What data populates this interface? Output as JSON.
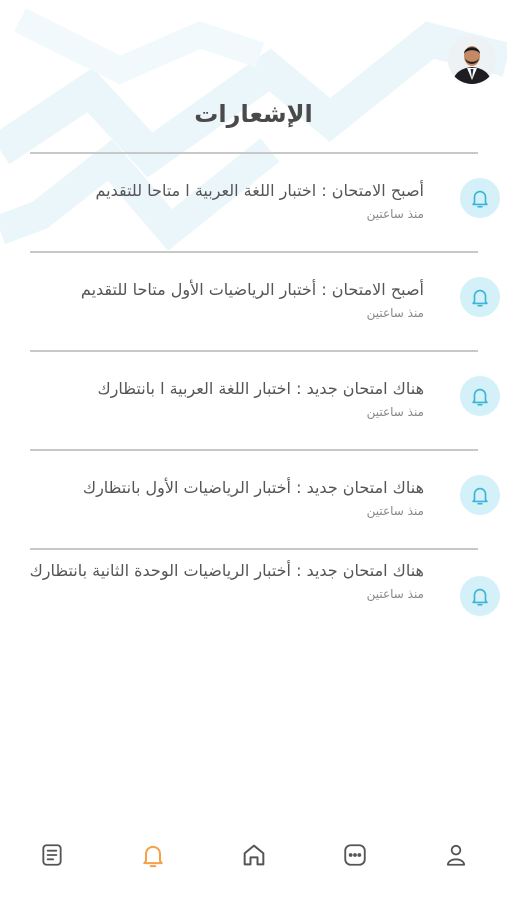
{
  "header": {
    "title": "الإشعارات"
  },
  "notifications": [
    {
      "message": "أصبح  الامتحان : اختبار اللغة العربية ا متاحا للتقديم",
      "time": "منذ ساعتين",
      "icon": "bell-icon"
    },
    {
      "message": "أصبح  الامتحان : أختبار الرياضيات الأول متاحا للتقديم",
      "time": "منذ ساعتين",
      "icon": "bell-icon"
    },
    {
      "message": "هناك  امتحان جديد : اختبار اللغة العربية ا بانتظارك",
      "time": "منذ ساعتين",
      "icon": "bell-icon"
    },
    {
      "message": "هناك  امتحان جديد : أختبار الرياضيات الأول بانتظارك",
      "time": "منذ ساعتين",
      "icon": "bell-icon"
    },
    {
      "message": "هناك  امتحان جديد : أختبار الرياضيات الوحدة الثانية بانتظارك",
      "time": "منذ ساعتين",
      "icon": "bell-icon"
    }
  ],
  "bottom_nav": {
    "items": [
      "document-icon",
      "bell-icon",
      "home-icon",
      "chat-icon",
      "profile-icon"
    ],
    "active": "bell-icon"
  },
  "colors": {
    "accent_active": "#f5a04a",
    "icon_inactive": "#555555",
    "bell_bg": "#d4f0f8",
    "bell_stroke": "#3cb4d6",
    "pattern": "#eaf6fa"
  }
}
